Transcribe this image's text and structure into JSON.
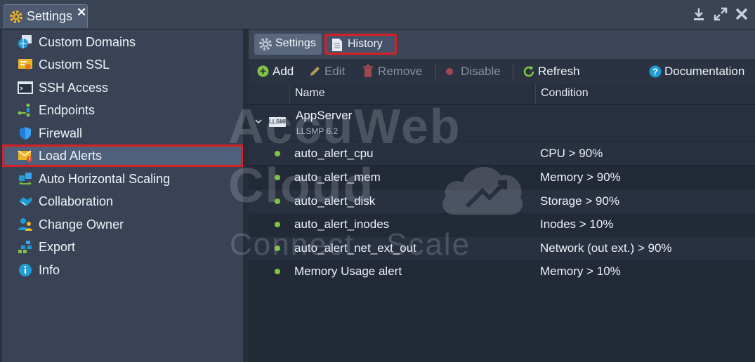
{
  "window": {
    "tab_title": "Settings",
    "icons": [
      "gear-icon",
      "close-icon",
      "download-icon",
      "expand-icon",
      "close-icon"
    ]
  },
  "sidebar": {
    "items": [
      {
        "label": "Custom Domains",
        "icon": "globe-icon"
      },
      {
        "label": "Custom SSL",
        "icon": "certificate-icon"
      },
      {
        "label": "SSH Access",
        "icon": "terminal-icon"
      },
      {
        "label": "Endpoints",
        "icon": "endpoints-icon"
      },
      {
        "label": "Firewall",
        "icon": "shield-icon"
      },
      {
        "label": "Load Alerts",
        "icon": "mail-alert-icon",
        "selected": true
      },
      {
        "label": "Auto Horizontal Scaling",
        "icon": "scaling-icon"
      },
      {
        "label": "Collaboration",
        "icon": "handshake-icon"
      },
      {
        "label": "Change Owner",
        "icon": "users-icon"
      },
      {
        "label": "Export",
        "icon": "export-icon"
      },
      {
        "label": "Info",
        "icon": "info-icon"
      }
    ]
  },
  "main": {
    "tabs": [
      {
        "label": "Settings",
        "icon": "gear-icon"
      },
      {
        "label": "History",
        "icon": "document-icon"
      }
    ],
    "toolbar": {
      "add": "Add",
      "edit": "Edit",
      "remove": "Remove",
      "disable": "Disable",
      "refresh": "Refresh",
      "documentation": "Documentation"
    },
    "table": {
      "columns": [
        "Name",
        "Condition"
      ],
      "group": {
        "name": "AppServer",
        "version": "LLSMP 6.2",
        "badge": "LLSMP"
      },
      "rows": [
        {
          "name": "auto_alert_cpu",
          "condition": "CPU > 90%"
        },
        {
          "name": "auto_alert_mem",
          "condition": "Memory > 90%"
        },
        {
          "name": "auto_alert_disk",
          "condition": "Storage > 90%"
        },
        {
          "name": "auto_alert_inodes",
          "condition": "Inodes > 10%"
        },
        {
          "name": "auto_alert_net_ext_out",
          "condition": "Network (out ext.) > 90%"
        },
        {
          "name": "Memory Usage alert",
          "condition": "Memory > 10%"
        }
      ]
    }
  },
  "watermark": {
    "line1": "AccuWeb",
    "line2": "Cloud",
    "line3": "Connect · Scale"
  },
  "colors": {
    "accent_red": "#d81f26",
    "status_green": "#7fc444",
    "selected_bg": "#4e607a"
  }
}
